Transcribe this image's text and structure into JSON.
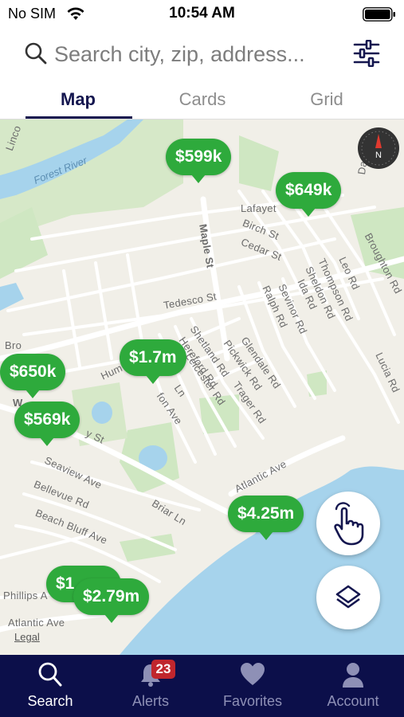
{
  "status_bar": {
    "carrier": "No SIM",
    "time": "10:54 AM",
    "wifi_icon": "wifi-icon",
    "battery_icon": "battery-full-icon"
  },
  "search": {
    "placeholder": "Search city, zip, address...",
    "value": "",
    "search_icon": "search-icon",
    "filter_icon": "sliders-icon"
  },
  "tabs": [
    {
      "label": "Map",
      "active": true
    },
    {
      "label": "Cards",
      "active": false
    },
    {
      "label": "Grid",
      "active": false
    }
  ],
  "map": {
    "water_label": "Forest River",
    "street_labels": [
      "Linco",
      "Lafayet",
      "Birch St",
      "Cedar St",
      "Dartmo",
      "Broughton Rd",
      "Maple St",
      "Leo Rd",
      "Thompson Rd",
      "Sheldon Rd",
      "Ida Rd",
      "Sevinor Rd",
      "Ralph Rd",
      "Tedesco St",
      "Lucia Rd",
      "Glendale Rd",
      "Pickwick Rd",
      "Shetland Rd",
      "Hereford Rd",
      "Leicester Rd",
      "Trager Rd",
      "Hum",
      "fon Ave",
      "Ln",
      "y St",
      "Bro",
      "W",
      "Seaview Ave",
      "Bellevue Rd",
      "Beach Bluff Ave",
      "Briar Ln",
      "Atlantic Ave",
      "Phillips A",
      "Atlantic Ave"
    ],
    "price_pins": [
      "$599k",
      "$649k",
      "$650k",
      "$1.7m",
      "$569k",
      "$4.25m",
      "$1",
      "$2.79m"
    ],
    "legal_label": "Legal",
    "compass_icon": "compass-icon",
    "draw_button_icon": "hand-pointer-icon",
    "layers_button_icon": "layers-icon"
  },
  "bottom_nav": [
    {
      "label": "Search",
      "icon": "search-icon",
      "active": true
    },
    {
      "label": "Alerts",
      "icon": "bell-icon",
      "active": false,
      "badge": "23"
    },
    {
      "label": "Favorites",
      "icon": "heart-icon",
      "active": false
    },
    {
      "label": "Account",
      "icon": "person-icon",
      "active": false
    }
  ],
  "colors": {
    "pin_green": "#2eaa3c",
    "nav_background": "#0c0f4a",
    "active_tab": "#14164f",
    "badge_red": "#c0262d",
    "water": "#a6d3ec",
    "park": "#cfe7c2"
  }
}
